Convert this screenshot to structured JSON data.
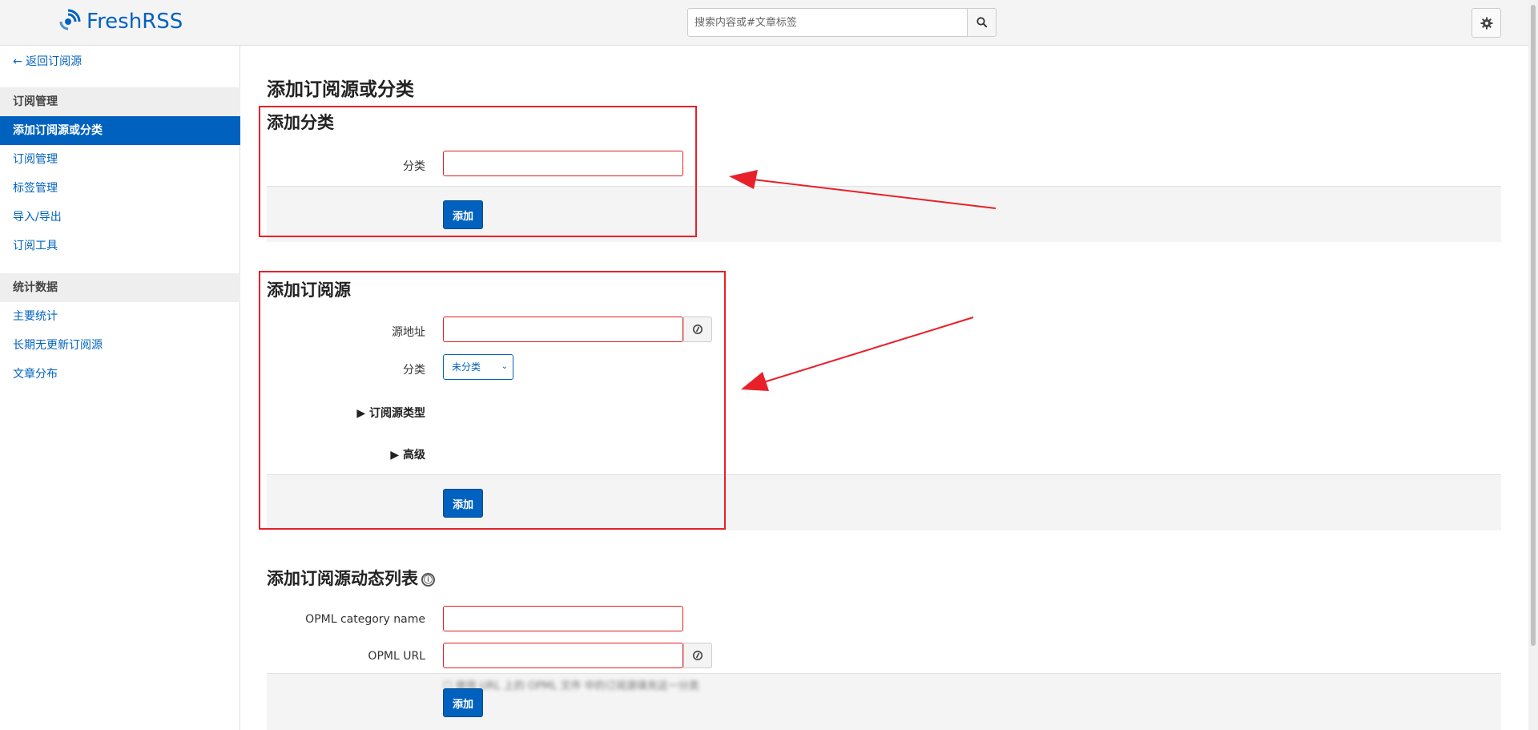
{
  "header": {
    "logo_text": "FreshRSS",
    "search_placeholder": "搜索内容或#文章标签",
    "search_icon": "search-icon",
    "settings_icon": "gear-icon",
    "brand_color": "#0062be"
  },
  "sidebar": {
    "back_label": "← 返回订阅源",
    "section1": "订阅管理",
    "items1": [
      "添加订阅源或分类",
      "订阅管理",
      "标签管理",
      "导入/导出",
      "订阅工具"
    ],
    "section2": "统计数据",
    "items2": [
      "主要统计",
      "长期无更新订阅源",
      "文章分布"
    ]
  },
  "main": {
    "page_title": "添加订阅源或分类",
    "add_category": {
      "title": "添加分类",
      "category_label": "分类",
      "submit": "添加"
    },
    "add_feed": {
      "title": "添加订阅源",
      "url_label": "源地址",
      "category_label": "分类",
      "category_value": "未分类",
      "type_summary": "▶ 订阅源类型",
      "advanced_summary": "▶ 高级",
      "submit": "添加"
    },
    "dynamic_opml": {
      "title": "添加订阅源动态列表",
      "info_icon": "ⓘ",
      "name_label": "OPML category name",
      "url_label": "OPML URL",
      "help_text": "☐ 使用 URL 上的 OPML 文件 中的订阅源填充这一分类",
      "submit": "添加"
    }
  },
  "annotation_color": "#e8202a"
}
